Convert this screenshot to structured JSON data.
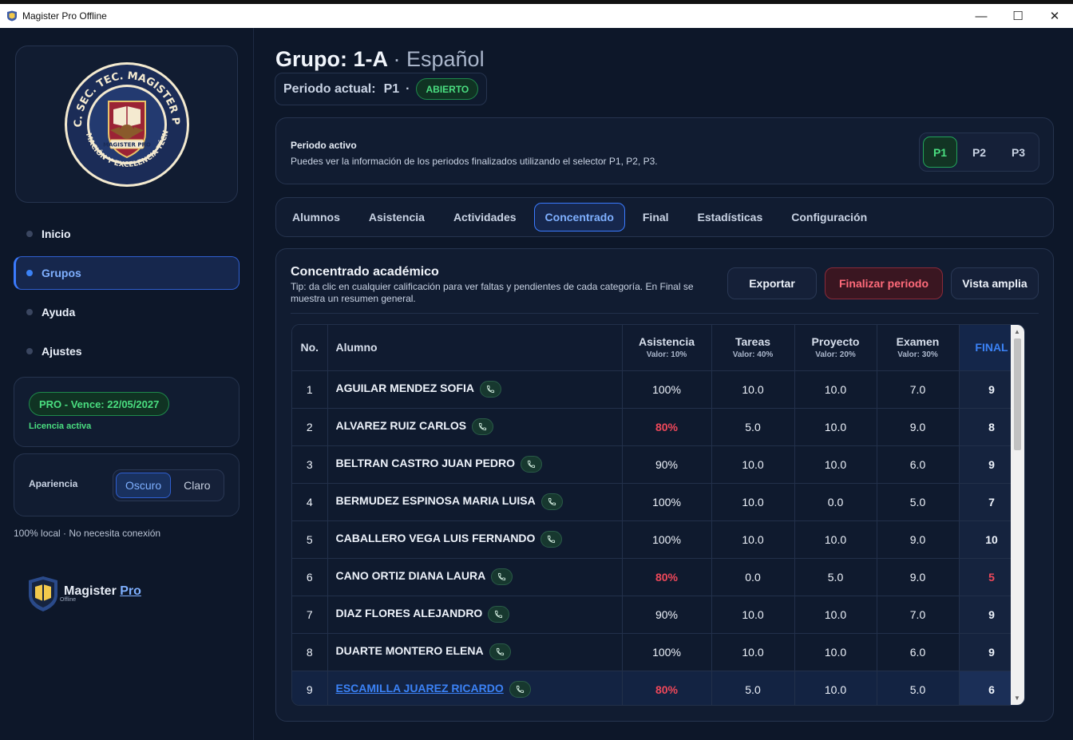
{
  "window": {
    "title": "Magister Pro Offline"
  },
  "sidebar": {
    "nav": [
      {
        "label": "Inicio"
      },
      {
        "label": "Grupos"
      },
      {
        "label": "Ayuda"
      },
      {
        "label": "Ajustes"
      }
    ],
    "license": {
      "badge": "PRO - Vence: 22/05/2027",
      "status": "Licencia activa"
    },
    "appearance": {
      "label": "Apariencia",
      "dark": "Oscuro",
      "light": "Claro"
    },
    "local_note": "100% local · No necesita conexión",
    "brand": {
      "name": "Magister",
      "pro": "Pro",
      "sub": "Offline"
    },
    "seal_text": "ESC. SEC. TEC. MAGISTER PRO · FORMACIÓN Y EXCELENCIA TÉCNICA · MAGISTER PRO"
  },
  "header": {
    "group": "Grupo: 1-A",
    "subject": "· Español",
    "period_label": "Periodo actual:",
    "period_value": "P1",
    "period_status": "ABIERTO"
  },
  "active_period": {
    "title": "Periodo activo",
    "desc": "Puedes ver la información de los periodos finalizados utilizando el selector P1, P2, P3.",
    "options": [
      "P1",
      "P2",
      "P3"
    ]
  },
  "tabs": [
    "Alumnos",
    "Asistencia",
    "Actividades",
    "Concentrado",
    "Final",
    "Estadísticas",
    "Configuración"
  ],
  "concentrado": {
    "title": "Concentrado académico",
    "tip": "Tip: da clic en cualquier calificación para ver faltas y pendientes de cada categoría. En Final se muestra un resumen general.",
    "buttons": {
      "export": "Exportar",
      "finalize": "Finalizar periodo",
      "wide": "Vista amplia"
    },
    "columns": {
      "no": "No.",
      "student": "Alumno",
      "attendance": "Asistencia",
      "attendance_sub": "Valor: 10%",
      "tasks": "Tareas",
      "tasks_sub": "Valor: 40%",
      "project": "Proyecto",
      "project_sub": "Valor: 20%",
      "exam": "Examen",
      "exam_sub": "Valor: 30%",
      "final": "FINAL"
    },
    "rows": [
      {
        "no": "1",
        "name": "AGUILAR MENDEZ SOFIA",
        "att": "100%",
        "tasks": "10.0",
        "project": "10.0",
        "exam": "7.0",
        "final": "9"
      },
      {
        "no": "2",
        "name": "ALVAREZ RUIZ CARLOS",
        "att": "80%",
        "tasks": "5.0",
        "project": "10.0",
        "exam": "9.0",
        "final": "8"
      },
      {
        "no": "3",
        "name": "BELTRAN CASTRO JUAN PEDRO",
        "att": "90%",
        "tasks": "10.0",
        "project": "10.0",
        "exam": "6.0",
        "final": "9"
      },
      {
        "no": "4",
        "name": "BERMUDEZ ESPINOSA MARIA LUISA",
        "att": "100%",
        "tasks": "10.0",
        "project": "0.0",
        "exam": "5.0",
        "final": "7"
      },
      {
        "no": "5",
        "name": "CABALLERO VEGA LUIS FERNANDO",
        "att": "100%",
        "tasks": "10.0",
        "project": "10.0",
        "exam": "9.0",
        "final": "10"
      },
      {
        "no": "6",
        "name": "CANO ORTIZ DIANA LAURA",
        "att": "80%",
        "tasks": "0.0",
        "project": "5.0",
        "exam": "9.0",
        "final": "5"
      },
      {
        "no": "7",
        "name": "DIAZ FLORES ALEJANDRO",
        "att": "90%",
        "tasks": "10.0",
        "project": "10.0",
        "exam": "7.0",
        "final": "9"
      },
      {
        "no": "8",
        "name": "DUARTE MONTERO ELENA",
        "att": "100%",
        "tasks": "10.0",
        "project": "10.0",
        "exam": "6.0",
        "final": "9"
      },
      {
        "no": "9",
        "name": "ESCAMILLA JUAREZ RICARDO",
        "att": "80%",
        "tasks": "5.0",
        "project": "10.0",
        "exam": "5.0",
        "final": "6"
      }
    ]
  },
  "colors": {
    "accent": "#3b82f6",
    "success": "#4ade80",
    "danger": "#f0485a",
    "bg": "#0d1729"
  },
  "icons": {
    "phone": "phone-icon",
    "app": "shield-book-icon"
  }
}
